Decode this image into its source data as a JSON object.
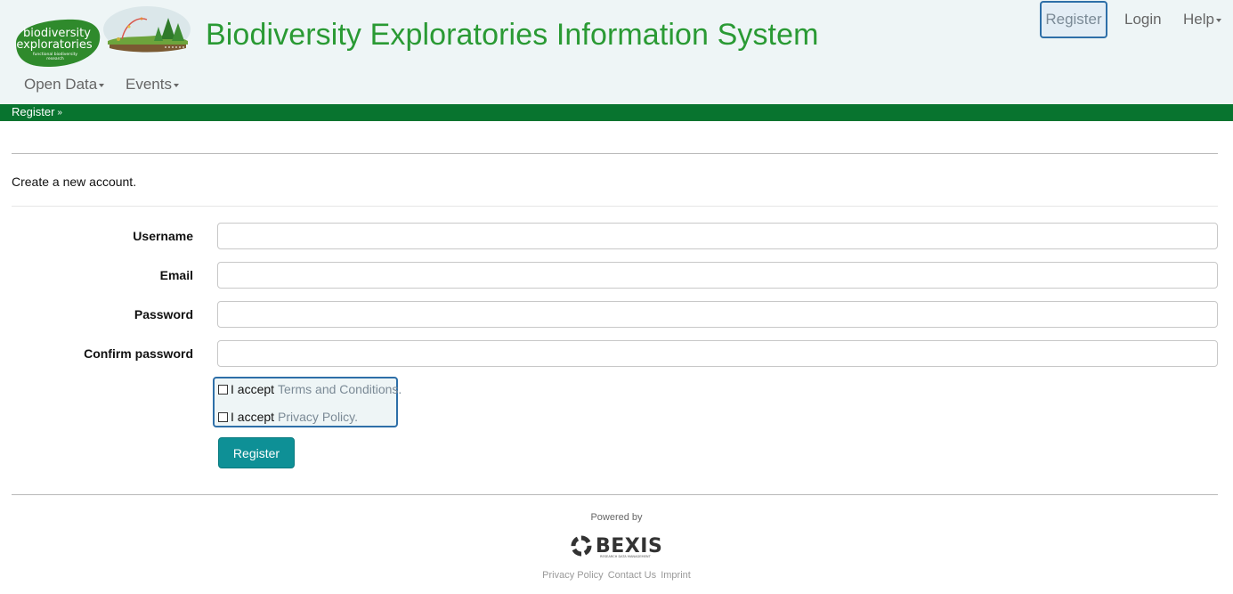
{
  "header": {
    "title": "Biodiversity Exploratories Information System",
    "logo_text_line1": "biodiversity",
    "logo_text_line2": "exploratories",
    "logo_text_line3": "functional biodiversity",
    "logo_text_line4": "research",
    "top_nav": {
      "register": "Register",
      "login": "Login",
      "help": "Help"
    },
    "main_nav": [
      {
        "label": "Open Data"
      },
      {
        "label": "Events"
      }
    ]
  },
  "breadcrumb": {
    "label": "Register",
    "icon": "double-chevron-down-icon"
  },
  "page": {
    "subtitle": "Create a new account."
  },
  "form": {
    "fields": [
      {
        "label": "Username",
        "value": "",
        "placeholder": ""
      },
      {
        "label": "Email",
        "value": "",
        "placeholder": ""
      },
      {
        "label": "Password",
        "value": "",
        "placeholder": ""
      },
      {
        "label": "Confirm password",
        "value": "",
        "placeholder": ""
      }
    ],
    "accept_terms": {
      "prefix": "I accept",
      "link": "Terms and Conditions.",
      "checked": false
    },
    "accept_privacy": {
      "prefix": "I accept",
      "link": "Privacy Policy.",
      "checked": false
    },
    "submit_label": "Register"
  },
  "footer": {
    "powered_by": "Powered by",
    "bexis_logo": "BEXIS",
    "bexis_sub": "RESEARCH DATA MANAGEMENT",
    "links": [
      "Privacy Policy",
      "Contact Us",
      "Imprint"
    ]
  },
  "colors": {
    "brand_green": "#2a9a34",
    "bar_green": "#08742f",
    "button_teal": "#0e9096",
    "focus_blue": "#2e6fa8",
    "header_bg": "#eef5f6"
  }
}
